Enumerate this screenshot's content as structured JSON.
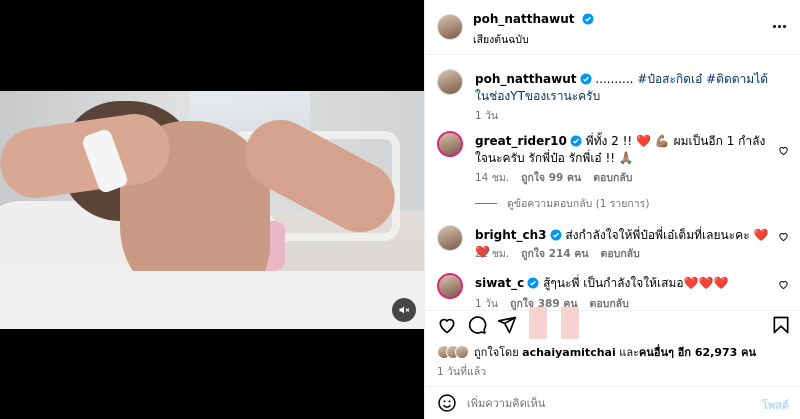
{
  "header": {
    "username": "poh_natthawut",
    "subtitle": "เสียงต้นฉบับ"
  },
  "caption": {
    "username": "poh_natthawut",
    "text": " .......... ",
    "hashtags": "#ป๋อสะกิดเอ๋ #ติดตามได้ในช่องYTของเรานะครับ",
    "time": "1 วัน"
  },
  "comments": [
    {
      "username": "great_rider10",
      "text": " พี่ทั้ง 2 !! ❤️ 💪🏽 ผมเป็นอีก 1 กำลังใจนะครับ รักพี่ป๋อ รักพี่เอ๋ !! 🙏🏽",
      "time": "14 ชม.",
      "likes": "ถูกใจ 99 คน",
      "reply": "ตอบกลับ"
    },
    {
      "username": "bright_ch3",
      "text": " ส่งกำลังใจให้พี่ป๋อพี่เอ๋เต็มที่เลยนะคะ ❤️❤️",
      "time": "22 ชม.",
      "likes": "ถูกใจ 214 คน",
      "reply": "ตอบกลับ"
    },
    {
      "username": "siwat_c",
      "text": " สู้ๆนะพี่ เป็นกำลังใจให้เสมอ❤️❤️❤️",
      "time": "1 วัน",
      "likes": "ถูกใจ 389 คน",
      "reply": "ตอบกลับ"
    }
  ],
  "replies_link": "ดูข้อความตอบกลับ (1 รายการ)",
  "likes": {
    "prefix": "ถูกใจโดย ",
    "user": "achaiyamitchai",
    "middle": " และ",
    "others": "คนอื่นๆ อีก 62,973 คน"
  },
  "post_time": "1 วันที่แล้ว",
  "comment_input": {
    "placeholder": "เพิ่มความคิดเห็น",
    "post_label": "โพสต์"
  },
  "colors": {
    "verified": "#0095f6",
    "heart": "#ff3040",
    "link": "#00376b",
    "post_disabled": "#b3dbff"
  },
  "icons": [
    "heart-icon",
    "comment-icon",
    "share-icon",
    "bookmark-icon",
    "emoji-icon",
    "more-icon",
    "mute-icon",
    "verified-icon"
  ]
}
